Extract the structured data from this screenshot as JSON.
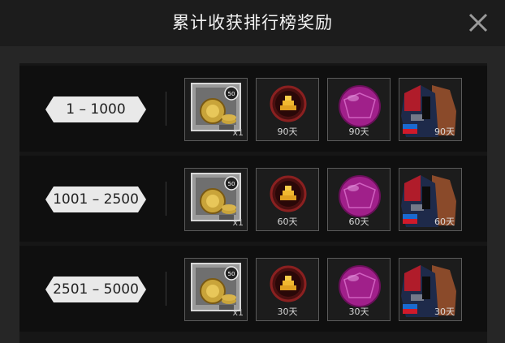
{
  "header": {
    "title": "累计收获排行榜奖励"
  },
  "icons": {
    "close": "close-icon"
  },
  "rows": [
    {
      "range": "1 – 1000",
      "coin_qty": "x1",
      "gold_days": "90天",
      "orb_days": "90天",
      "jacket_days": "90天"
    },
    {
      "range": "1001 – 2500",
      "coin_qty": "x1",
      "gold_days": "60天",
      "orb_days": "60天",
      "jacket_days": "60天"
    },
    {
      "range": "2501 – 5000",
      "coin_qty": "x1",
      "gold_days": "30天",
      "orb_days": "30天",
      "jacket_days": "30天"
    }
  ]
}
